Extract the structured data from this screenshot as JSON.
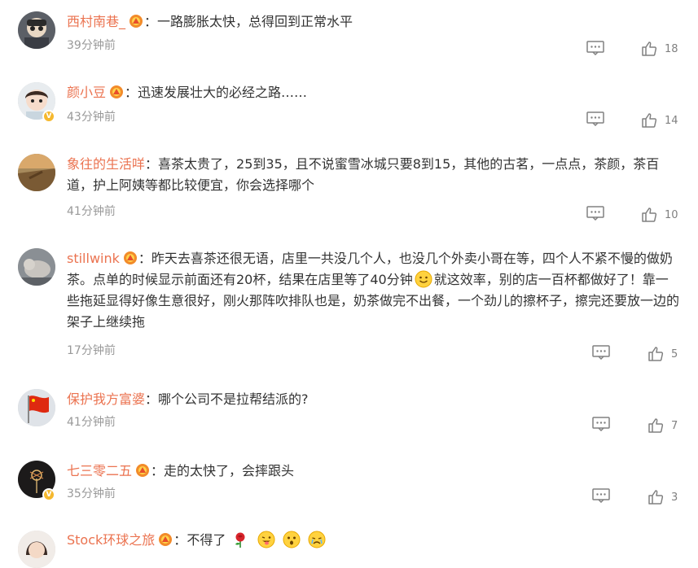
{
  "comments": [
    {
      "username": "西村南巷_",
      "separator": "：",
      "text": "一路膨胀太快，总得回到正常水平",
      "time": "39分钟前",
      "likes": "18"
    },
    {
      "username": "颜小豆",
      "separator": "：",
      "text": "迅速发展壮大的必经之路……",
      "time": "43分钟前",
      "likes": "14"
    },
    {
      "username": "象往的生活咩",
      "separator": "：",
      "text": "喜茶太贵了，25到35，且不说蜜雪冰城只要8到15，其他的古茗，一点点，茶颜，茶百道，护上阿姨等都比较便宜，你会选择哪个",
      "time": "41分钟前",
      "likes": "10"
    },
    {
      "username": "stillwink",
      "separator": "：",
      "text_a": "昨天去喜茶还很无语，店里一共没几个人，也没几个外卖小哥在等，四个人不紧不慢的做奶茶。点单的时候显示前面还有20杯，结果在店里等了40分钟",
      "text_b": "就这效率，别的店一百杯都做好了！靠一些拖延显得好像生意很好，刚火那阵吹排队也是，奶茶做完不出餐，一个劲儿的擦杯子，擦完还要放一边的架子上继续拖",
      "time": "17分钟前",
      "likes": "5"
    },
    {
      "username": "保护我方富婆",
      "separator": "：",
      "text": "哪个公司不是拉帮结派的?",
      "time": "41分钟前",
      "likes": "7"
    },
    {
      "username": "七三零二五",
      "separator": "：",
      "text": "走的太快了，会摔跟头",
      "time": "35分钟前",
      "likes": "3"
    },
    {
      "username": "Stock环球之旅",
      "separator": "：",
      "text": "不得了"
    }
  ],
  "icons": {
    "reply": "comment-icon",
    "like": "thumbs-up-icon",
    "medal": "fan-medal-icon",
    "verified": "verified-badge-icon"
  },
  "colors": {
    "username": "#eb7350",
    "text": "#333333",
    "meta": "#999999"
  }
}
